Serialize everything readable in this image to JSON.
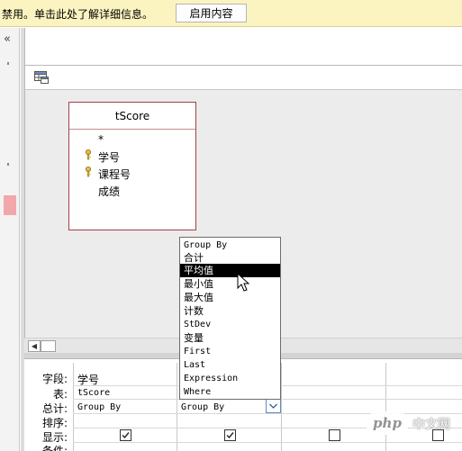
{
  "message_bar": {
    "text": "禁用。单击此处了解详细信息。",
    "enable_button": "启用内容"
  },
  "nav": {
    "collapse_glyph": "«"
  },
  "table": {
    "name": "tScore",
    "fields": [
      {
        "name": "*",
        "primary_key": false
      },
      {
        "name": "学号",
        "primary_key": true
      },
      {
        "name": "课程号",
        "primary_key": true
      },
      {
        "name": "成绩",
        "primary_key": false
      }
    ]
  },
  "grid": {
    "row_labels": {
      "field": "字段:",
      "table": "表:",
      "total": "总计:",
      "sort": "排序:",
      "show": "显示:",
      "criteria": "条件:"
    },
    "columns": [
      {
        "field": "学号",
        "table": "tScore",
        "total": "Group By",
        "show": true
      },
      {
        "field": "",
        "table": "",
        "total": "Group By",
        "show": true
      },
      {
        "field": "",
        "table": "",
        "total": "",
        "show": false
      },
      {
        "field": "",
        "table": "",
        "total": "",
        "show": false
      }
    ]
  },
  "dropdown": {
    "selected": "平均值",
    "options": [
      "Group By",
      "合计",
      "平均值",
      "最小值",
      "最大值",
      "计数",
      "StDev",
      "变量",
      "First",
      "Last",
      "Expression",
      "Where"
    ]
  },
  "watermark": {
    "logo": "php",
    "text": "中文网"
  },
  "colors": {
    "message_bar_bg": "#fbf4c0",
    "table_border": "#a34046",
    "selection_bg": "#000000",
    "accent_blue": "#5b8bc9"
  }
}
